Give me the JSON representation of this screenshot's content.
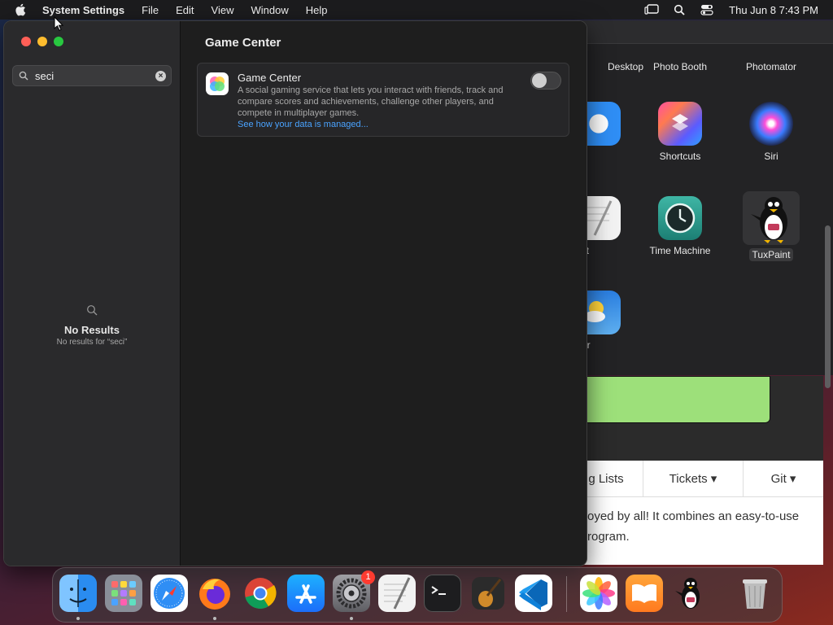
{
  "menubar": {
    "app_name": "System Settings",
    "items": [
      "File",
      "Edit",
      "View",
      "Window",
      "Help"
    ],
    "clock": "Thu Jun 8  7:43 PM"
  },
  "launchpad": {
    "tiles": [
      {
        "label": "Desktop",
        "icon": "desktop-icon"
      },
      {
        "label": "Photo Booth",
        "icon": "photo-booth-icon"
      },
      {
        "label": "Photomator",
        "icon": "photomator-icon"
      },
      {
        "label": "fari",
        "icon": "safari-icon"
      },
      {
        "label": "Shortcuts",
        "icon": "shortcuts-icon"
      },
      {
        "label": "Siri",
        "icon": "siri-icon"
      },
      {
        "label": "tEdit",
        "icon": "textedit-icon"
      },
      {
        "label": "Time Machine",
        "icon": "time-machine-icon"
      },
      {
        "label": "TuxPaint",
        "icon": "tuxpaint-icon"
      },
      {
        "label": "ather",
        "icon": "weather-icon"
      }
    ]
  },
  "webpage": {
    "nav": [
      "g Lists",
      "Tickets ▾",
      "Git ▾"
    ],
    "para_line1": "oyed by all! It combines an easy-to-use",
    "para_line2": "rogram."
  },
  "settings": {
    "search": {
      "value": "seci"
    },
    "no_results": {
      "title": "No Results",
      "subtitle": "No results for “seci”"
    },
    "page_title": "Game Center",
    "game_center": {
      "name": "Game Center",
      "description": "A social gaming service that lets you interact with friends, track and compare scores and achievements, challenge other players, and compete in multiplayer games.",
      "link": "See how your data is managed...",
      "enabled": false
    }
  },
  "dock": {
    "items": [
      {
        "name": "finder",
        "color": "#2a8cf0"
      },
      {
        "name": "launchpad",
        "color": "#8a8f99"
      },
      {
        "name": "safari",
        "color": "#2f8ef5"
      },
      {
        "name": "firefox",
        "color": "#ff7a1a"
      },
      {
        "name": "chrome",
        "color": "#ffffff"
      },
      {
        "name": "app-store",
        "color": "#1c8ef9"
      },
      {
        "name": "system-settings",
        "color": "#8e8e93"
      },
      {
        "name": "textedit",
        "color": "#f2f2f2"
      },
      {
        "name": "terminal",
        "color": "#1d1d1f"
      },
      {
        "name": "garageband",
        "color": "#2b2b2b"
      },
      {
        "name": "vscode",
        "color": "#ffffff"
      },
      {
        "name": "photos",
        "color": "#ffffff"
      },
      {
        "name": "books",
        "color": "#ff8a1f"
      },
      {
        "name": "tuxpaint",
        "color": "#1a1a1a"
      },
      {
        "name": "trash",
        "color": "#b8b8b8"
      }
    ],
    "settings_badge": "1"
  }
}
